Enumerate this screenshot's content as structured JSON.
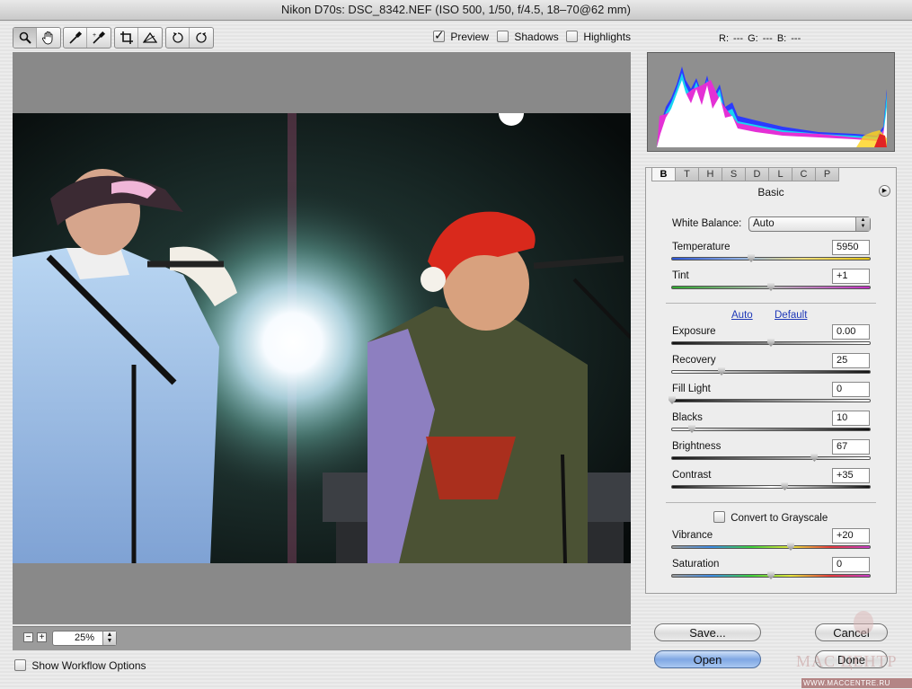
{
  "window": {
    "title": "Nikon D70s:  DSC_8342.NEF  (ISO 500, 1/50, f/4.5, 18–70@62 mm)"
  },
  "toolbar": {
    "tools": [
      "zoom-icon",
      "hand-icon",
      "white-balance-eyedropper-icon",
      "color-sampler-icon",
      "crop-icon",
      "straighten-icon",
      "rotate-left-icon",
      "rotate-right-icon"
    ]
  },
  "view_options": {
    "preview": {
      "label": "Preview",
      "checked": true
    },
    "shadows": {
      "label": "Shadows",
      "checked": false
    },
    "highlights": {
      "label": "Highlights",
      "checked": false
    }
  },
  "readout": {
    "text": "R: ---   G: ---   B: ---"
  },
  "zoom": {
    "minus": "−",
    "plus": "+",
    "value": "25%"
  },
  "workflow": {
    "label": "Show Workflow Options",
    "checked": false
  },
  "panel": {
    "tabs": [
      "B",
      "T",
      "H",
      "S",
      "D",
      "L",
      "C",
      "P"
    ],
    "active_tab": "B",
    "section_title": "Basic",
    "white_balance": {
      "label": "White Balance:",
      "value": "Auto"
    },
    "auto_link": "Auto",
    "default_link": "Default",
    "grayscale": {
      "label": "Convert to Grayscale",
      "checked": false
    },
    "controls": {
      "temperature": {
        "label": "Temperature",
        "value": "5950",
        "level": 0.4
      },
      "tint": {
        "label": "Tint",
        "value": "+1",
        "level": 0.5
      },
      "exposure": {
        "label": "Exposure",
        "value": "0.00",
        "level": 0.5
      },
      "recovery": {
        "label": "Recovery",
        "value": "25",
        "level": 0.25
      },
      "fill_light": {
        "label": "Fill Light",
        "value": "0",
        "level": 0.0
      },
      "blacks": {
        "label": "Blacks",
        "value": "10",
        "level": 0.1
      },
      "brightness": {
        "label": "Brightness",
        "value": "67",
        "level": 0.72
      },
      "contrast": {
        "label": "Contrast",
        "value": "+35",
        "level": 0.57
      },
      "vibrance": {
        "label": "Vibrance",
        "value": "+20",
        "level": 0.6
      },
      "saturation": {
        "label": "Saturation",
        "value": "0",
        "level": 0.5
      }
    }
  },
  "buttons": {
    "save": "Save...",
    "cancel": "Cancel",
    "open": "Open",
    "done": "Done"
  },
  "watermark": {
    "brand": "MAC ЦЕНТР",
    "url": "WWW.MACCENTRE.RU"
  },
  "colors": {
    "default_button": "#7fa7e3",
    "link": "#1f39b8",
    "preview_bg": "#898989"
  }
}
